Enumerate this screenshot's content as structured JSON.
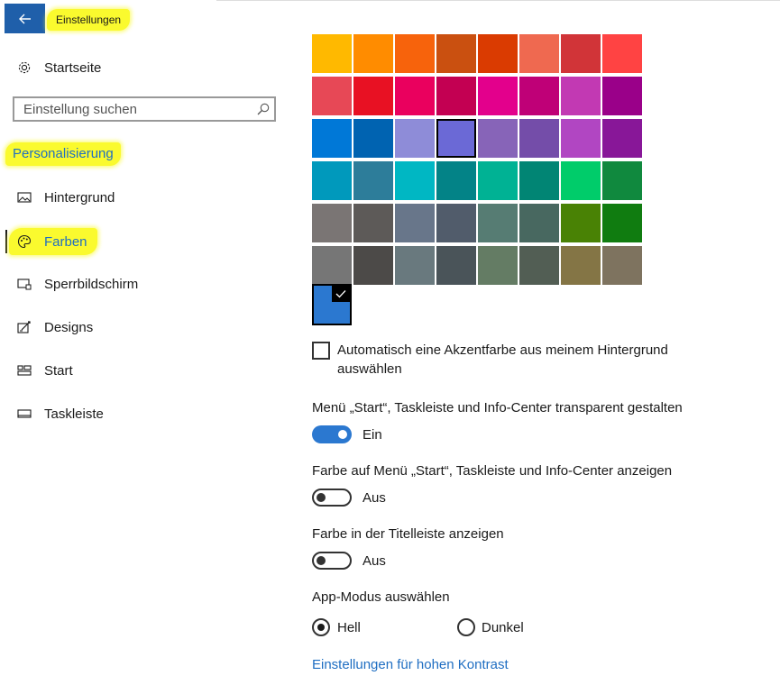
{
  "header": {
    "title": "Einstellungen"
  },
  "nav": {
    "home_label": "Startseite",
    "search_placeholder": "Einstellung suchen",
    "section_title": "Personalisierung",
    "items": [
      {
        "label": "Hintergrund",
        "icon": "picture-icon"
      },
      {
        "label": "Farben",
        "icon": "palette-icon",
        "selected": true
      },
      {
        "label": "Sperrbildschirm",
        "icon": "lock-screen-icon"
      },
      {
        "label": "Designs",
        "icon": "designs-icon"
      },
      {
        "label": "Start",
        "icon": "start-icon"
      },
      {
        "label": "Taskleiste",
        "icon": "taskbar-icon"
      }
    ]
  },
  "accent_colors": [
    [
      "#ffb900",
      "#ff8c00",
      "#f7630c",
      "#ca5010",
      "#da3b01",
      "#ef6950",
      "#d13438",
      "#ff4343"
    ],
    [
      "#e74856",
      "#e81123",
      "#ea005e",
      "#c30052",
      "#e3008c",
      "#bf0077",
      "#c239b3",
      "#9a0089"
    ],
    [
      "#0078d7",
      "#0063b1",
      "#8e8cd8",
      "#6b69d6",
      "#8764b8",
      "#744da9",
      "#b146c2",
      "#881798"
    ],
    [
      "#0099bc",
      "#2d7d9a",
      "#00b7c3",
      "#038387",
      "#00b294",
      "#018574",
      "#00cc6a",
      "#10893e"
    ],
    [
      "#7a7574",
      "#5d5a58",
      "#68768a",
      "#515c6b",
      "#567c73",
      "#486860",
      "#498205",
      "#107c10"
    ],
    [
      "#767676",
      "#4c4a48",
      "#69797e",
      "#4a5459",
      "#647c64",
      "#525e54",
      "#847545",
      "#7e735f"
    ]
  ],
  "selected_swatch": {
    "row": 2,
    "col": 3
  },
  "custom_color": "#2b78d0",
  "auto_accent": {
    "label": "Automatisch eine Akzentfarbe aus meinem Hintergrund auswählen",
    "checked": false
  },
  "transparency": {
    "label": "Menü „Start“, Taskleiste und Info-Center transparent gestalten",
    "state": "Ein",
    "on": true
  },
  "color_on_start": {
    "label": "Farbe auf Menü „Start“, Taskleiste und Info-Center anzeigen",
    "state": "Aus",
    "on": false
  },
  "color_titlebar": {
    "label": "Farbe in der Titelleiste anzeigen",
    "state": "Aus",
    "on": false
  },
  "app_mode": {
    "label": "App-Modus auswählen",
    "options": [
      "Hell",
      "Dunkel"
    ],
    "selected": "Hell"
  },
  "high_contrast_link": "Einstellungen für hohen Kontrast"
}
